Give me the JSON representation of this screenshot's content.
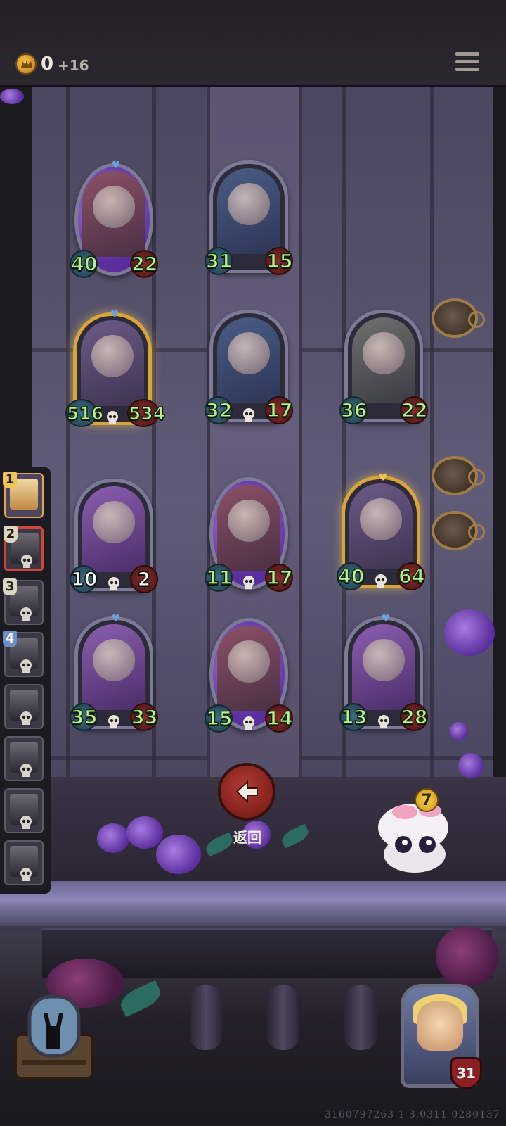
{
  "hud": {
    "gold": "0",
    "gold_increment": "+16"
  },
  "board": {
    "cards": [
      {
        "atk": "40",
        "hp": "22",
        "frame": "rose"
      },
      {
        "atk": "31",
        "hp": "15",
        "frame": "blue"
      },
      {
        "atk": "516",
        "hp": "534",
        "frame": "gold"
      },
      {
        "atk": "32",
        "hp": "17",
        "frame": "blue"
      },
      {
        "atk": "36",
        "hp": "22",
        "frame": "gray"
      },
      {
        "atk": "10",
        "hp": "2",
        "frame": "purple"
      },
      {
        "atk": "11",
        "hp": "17",
        "frame": "rose"
      },
      {
        "atk": "40",
        "hp": "64",
        "frame": "gold"
      },
      {
        "atk": "35",
        "hp": "33",
        "frame": "purple"
      },
      {
        "atk": "15",
        "hp": "14",
        "frame": "rose"
      },
      {
        "atk": "13",
        "hp": "28",
        "frame": "purple"
      }
    ]
  },
  "opponents": [
    {
      "rank": "1"
    },
    {
      "rank": "2"
    },
    {
      "rank": "3"
    },
    {
      "rank": "4"
    },
    {
      "rank": ""
    },
    {
      "rank": ""
    },
    {
      "rank": ""
    },
    {
      "rank": ""
    }
  ],
  "actions": {
    "back_label": "返回"
  },
  "mascot": {
    "badge": "7"
  },
  "hero": {
    "hp": "31"
  },
  "footer": {
    "build_id": "3160797263 1 3.0311 0280137"
  },
  "colors": {
    "stat_green": "#b8f28a",
    "back_button": "#b23a34",
    "gold_frame": "#d9a537"
  }
}
